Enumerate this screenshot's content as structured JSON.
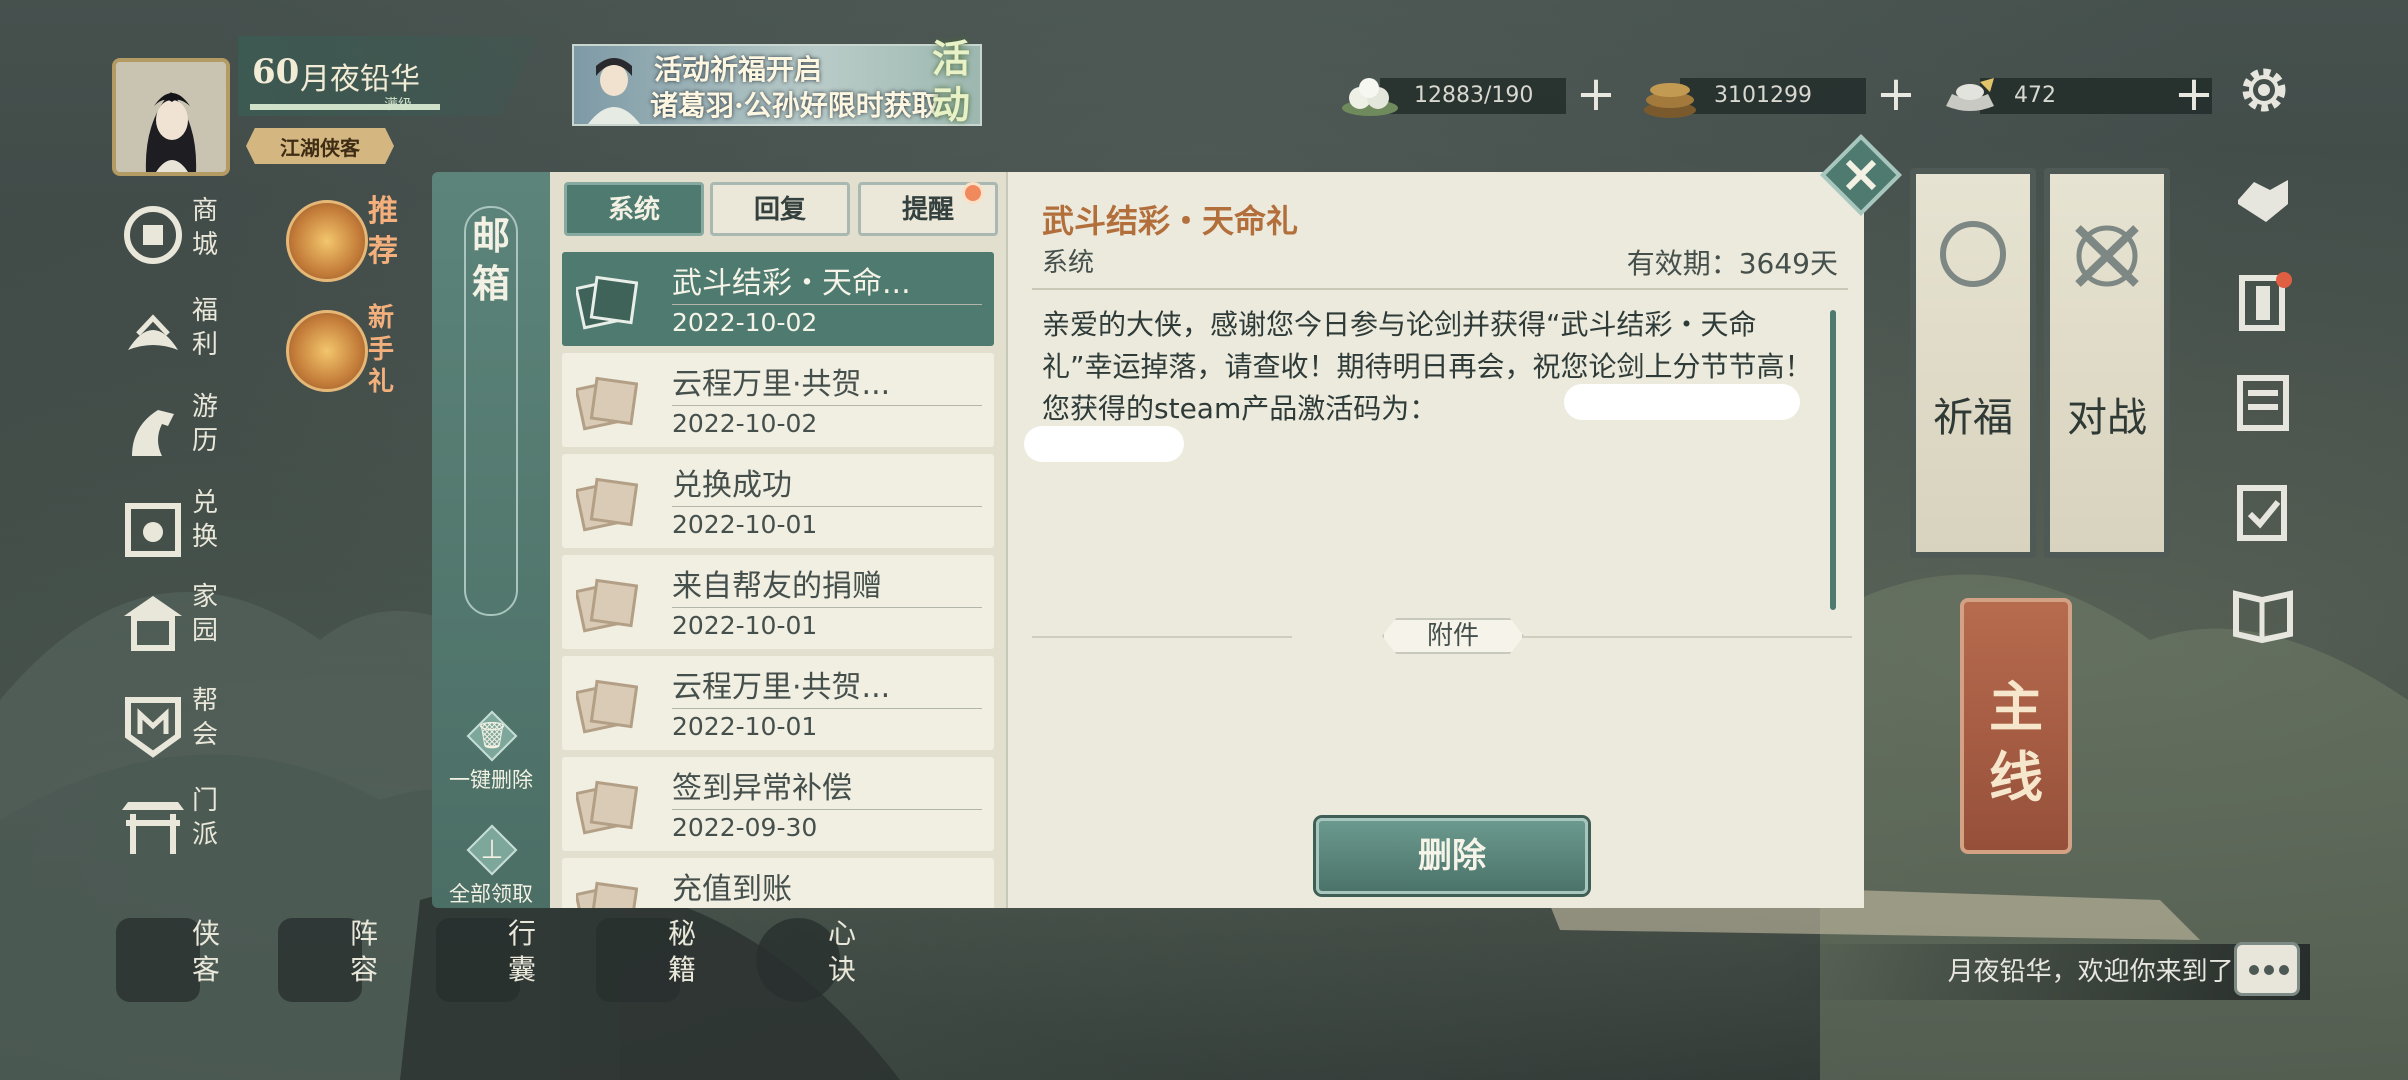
{
  "player": {
    "level": "60",
    "name": "月夜铅华",
    "level_status": "满级",
    "level_fill": 1.0,
    "title_badge": "江湖侠客"
  },
  "event_banner": {
    "line1": "活动祈福开启",
    "line2": "诸葛羽·公孙好限时获取",
    "tag": "活动"
  },
  "currencies": [
    {
      "icon": "dumpling-icon",
      "value": "12883/190"
    },
    {
      "icon": "coins-icon",
      "value": "3101299"
    },
    {
      "icon": "silver-ingot-icon",
      "value": "472"
    }
  ],
  "left_sidebar": [
    {
      "icon": "shop-icon",
      "label": "商城"
    },
    {
      "icon": "welfare-icon",
      "label": "福利"
    },
    {
      "icon": "horse-icon",
      "label": "游历"
    },
    {
      "icon": "exchange-icon",
      "label": "兑换"
    },
    {
      "icon": "home-icon",
      "label": "家园"
    },
    {
      "icon": "guild-icon",
      "label": "帮会"
    },
    {
      "icon": "sect-gate-icon",
      "label": "门派"
    }
  ],
  "promo_items": [
    {
      "icon": "lotus-icon",
      "label": "推荐"
    },
    {
      "icon": "snowflake-icon",
      "label": "新手礼"
    }
  ],
  "bottom_bar": [
    {
      "icon": "hero-icon",
      "label": "侠客"
    },
    {
      "icon": "formation-icon",
      "label": "阵容"
    },
    {
      "icon": "bag-icon",
      "label": "行囊"
    },
    {
      "icon": "book-icon",
      "label": "秘籍"
    },
    {
      "icon": "heart-method-icon",
      "label": "心诀"
    }
  ],
  "right_panels": {
    "pray_label": "祈福",
    "battle_label": "对战",
    "mainline_label": "主线"
  },
  "welcome_text": "月夜铅华，欢迎你来到了江湖!",
  "mailbox": {
    "title": "邮箱",
    "delete_all_label": "一键删除",
    "claim_all_label": "全部领取",
    "tabs": [
      "系统",
      "回复",
      "提醒"
    ],
    "mails": [
      {
        "subject": "武斗结彩・天命...",
        "date": "2022-10-02",
        "selected": true
      },
      {
        "subject": "云程万里·共贺...",
        "date": "2022-10-02",
        "selected": false
      },
      {
        "subject": "兑换成功",
        "date": "2022-10-01",
        "selected": false
      },
      {
        "subject": "来自帮友的捐赠",
        "date": "2022-10-01",
        "selected": false
      },
      {
        "subject": "云程万里·共贺...",
        "date": "2022-10-01",
        "selected": false
      },
      {
        "subject": "签到异常补偿",
        "date": "2022-09-30",
        "selected": false
      },
      {
        "subject": "充值到账",
        "date": "",
        "selected": false
      }
    ],
    "detail": {
      "title": "武斗结彩・天命礼",
      "sender": "系统",
      "validity": "有效期：3649天",
      "body": "亲爱的大侠，感谢您今日参与论剑并获得“武斗结彩・天命礼”幸运掉落，请查收！期待明日再会，祝您论剑上分节节高！您获得的steam产品激活码为：",
      "attachment_label": "附件",
      "delete_label": "删除"
    }
  },
  "colors": {
    "accent_teal": "#4f7a70",
    "title_orange": "#b26f3c",
    "panel_bg": "#eceadc"
  }
}
